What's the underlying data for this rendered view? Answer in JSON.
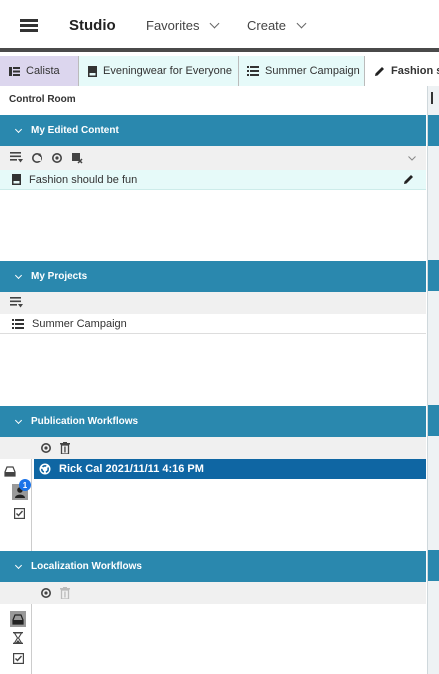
{
  "topbar": {
    "brand": "Studio",
    "menus": [
      {
        "label": "Favorites"
      },
      {
        "label": "Create"
      }
    ]
  },
  "tabs": [
    {
      "label": "Calista",
      "icon": "list-card-icon",
      "color": "#dcd6ee"
    },
    {
      "label": "Eveningwear for Everyone",
      "icon": "document-icon",
      "color": "#e6faf9"
    },
    {
      "label": "Summer Campaign",
      "icon": "list-icon",
      "color": "#e6faf9"
    },
    {
      "label": "Fashion sh",
      "icon": "pencil-icon",
      "color": "#ffffff"
    }
  ],
  "control_room": {
    "label": "Control Room",
    "edited_content": {
      "title": "My Edited Content",
      "items": [
        {
          "label": "Fashion should be fun"
        }
      ]
    },
    "projects": {
      "title": "My Projects",
      "items": [
        {
          "label": "Summer Campaign"
        }
      ]
    },
    "publication_workflows": {
      "title": "Publication Workflows",
      "badge_count": "1",
      "items": [
        {
          "label": "Rick Cal 2021/11/11 4:16 PM"
        }
      ]
    },
    "localization_workflows": {
      "title": "Localization Workflows"
    }
  },
  "colors": {
    "section_header": "#2a88ae",
    "selected_row": "#0f66a3",
    "light_row": "#e6faf9"
  }
}
